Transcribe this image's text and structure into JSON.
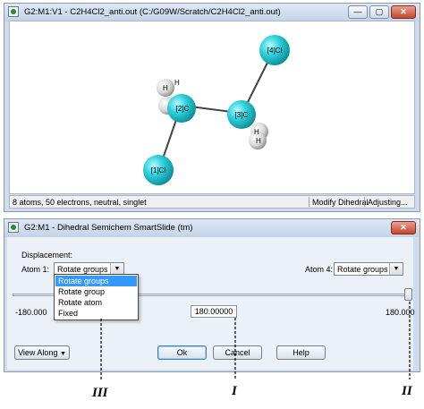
{
  "viewer": {
    "title": "G2:M1:V1 - C2H4Cl2_anti.out (C:/G09W/Scratch/C2H4Cl2_anti.out)",
    "status": {
      "info": "8 atoms, 50 electrons, neutral, singlet",
      "mode": "Modify Dihedral",
      "state": "Adjusting..."
    },
    "atom_labels": [
      "[4]Cl",
      "[2]C",
      "[3]C",
      "[1]Cl"
    ],
    "hydrogen_label": "H",
    "colors": {
      "chlorine": "#2fd1dc",
      "carbon": "#20c4cc",
      "hydrogen": "#f0f0f0",
      "bond": "#444444"
    }
  },
  "dialog": {
    "title": "G2:M1 - Dihedral Semichem SmartSlide (tm)",
    "displacement_label": "Displacement:",
    "atom1_label": "Atom 1:",
    "atom1_value": "Rotate groups",
    "atom4_label": "Atom 4:",
    "atom4_value": "Rotate groups",
    "dropdown_options": [
      "Rotate groups",
      "Rotate group",
      "Rotate atom",
      "Fixed"
    ],
    "dropdown_selected": "Rotate groups",
    "slider_min": "-180.000",
    "slider_max": "180.000",
    "slider_value": "180.00000",
    "slider_fraction": 1.0,
    "buttons": {
      "view_along": "View Along",
      "ok": "Ok",
      "cancel": "Cancel",
      "help": "Help"
    }
  },
  "annotations": {
    "I": "I",
    "II": "II",
    "III": "III"
  },
  "window_controls": {
    "minimize": "—",
    "restore": "▢",
    "close": "✕"
  }
}
